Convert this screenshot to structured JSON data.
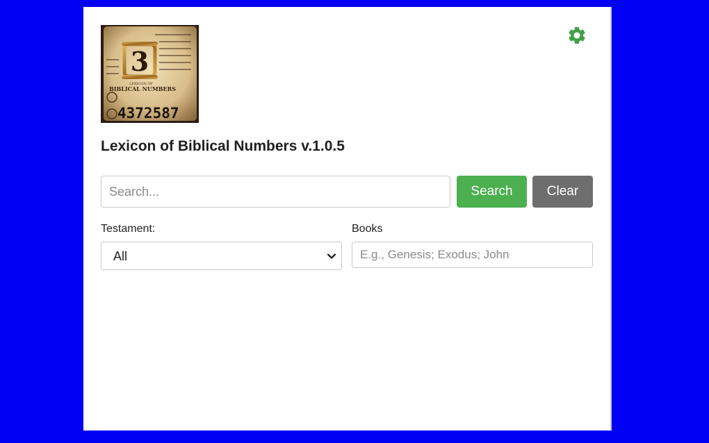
{
  "app": {
    "title": "Lexicon of Biblical Numbers v.1.0.5"
  },
  "logo": {
    "big_numeral": "3",
    "number_text": "4372587",
    "caption_small": "LEXICON OF",
    "caption_main": "BIBLICAL NUMBERS",
    "icon": "scroll-logo"
  },
  "settings": {
    "icon": "gear-icon",
    "color": "#43a047"
  },
  "search": {
    "placeholder": "Search...",
    "value": "",
    "search_label": "Search",
    "clear_label": "Clear"
  },
  "filters": {
    "testament_label": "Testament:",
    "testament_selected": "All",
    "books_label": "Books",
    "books_placeholder": "E.g., Genesis; Exodus; John",
    "books_value": ""
  },
  "colors": {
    "background": "#0000f5",
    "search_button": "#4caf50",
    "clear_button": "#6e6e6e"
  }
}
